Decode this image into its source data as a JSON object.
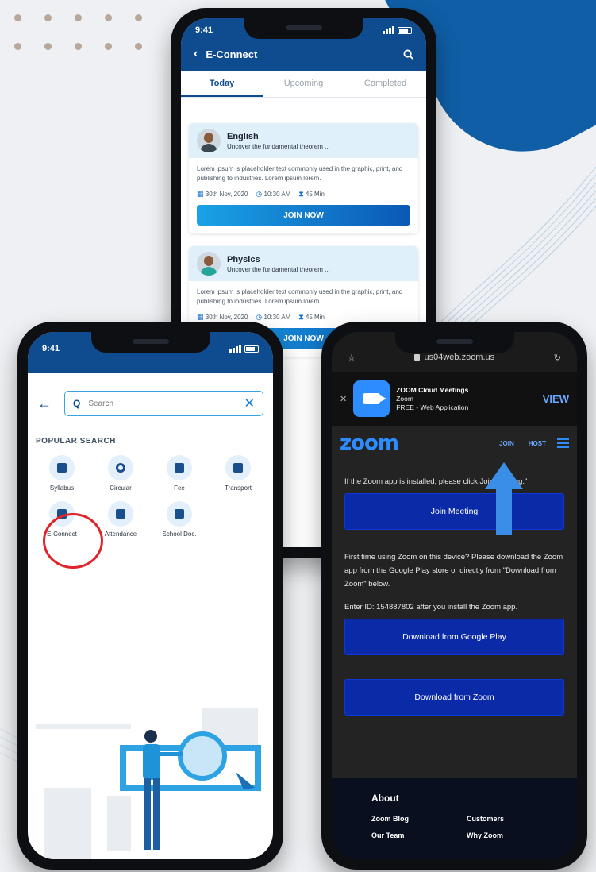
{
  "phone_econnect": {
    "time": "9:41",
    "title": "E-Connect",
    "tabs": [
      "Today",
      "Upcoming",
      "Completed"
    ],
    "classes": [
      {
        "subject": "English",
        "subtitle": "Uncover the fundamental theorem ...",
        "body": "Lorem ipsum is placeholder text commonly used in the graphic, print, and publishing to industries. Lorem ipsum lorem.",
        "date": "30th Nov, 2020",
        "time": "10:30 AM",
        "duration": "45 Min",
        "button": "JOIN NOW"
      },
      {
        "subject": "Physics",
        "subtitle": "Uncover the fundamental theorem ...",
        "body": "Lorem ipsum is placeholder text commonly used in the graphic, print, and publishing to industries. Lorem ipsum lorem.",
        "date": "30th Nov, 2020",
        "time": "10:30 AM",
        "duration": "45 Min",
        "button": "JOIN NOW"
      }
    ]
  },
  "phone_search": {
    "time": "9:41",
    "search_placeholder": "Search",
    "popular_title": "POPULAR SEARCH",
    "items": [
      "Syllabus",
      "Circular",
      "Fee",
      "Transport",
      "E-Connect",
      "Attendance",
      "School Doc."
    ]
  },
  "phone_zoom": {
    "url": "us04web.zoom.us",
    "app_banner": {
      "name": "ZOOM Cloud Meetings",
      "developer": "Zoom",
      "price": "FREE - Web Application",
      "action": "VIEW"
    },
    "logo": "zoom",
    "nav": [
      "JOIN",
      "HOST"
    ],
    "instruction": "If the Zoom app is installed, please click Join Meeting.\"",
    "join_button": "Join Meeting",
    "first_time_text": "First time using Zoom on this device? Please download the Zoom app from the Google Play store or directly from \"Download from Zoom\" below.",
    "enter_id_text": "Enter ID: 154887802 after you install the Zoom app.",
    "google_play_button": "Download from Google Play",
    "zoom_download_button": "Download from Zoom",
    "footer": {
      "heading": "About",
      "links": [
        "Zoom Blog",
        "Customers",
        "Our Team",
        "Why Zoom"
      ]
    }
  },
  "colors": {
    "brand_blue": "#0e4b8f",
    "accent_red": "#e0242b",
    "zoom_blue": "#2d8cff"
  }
}
